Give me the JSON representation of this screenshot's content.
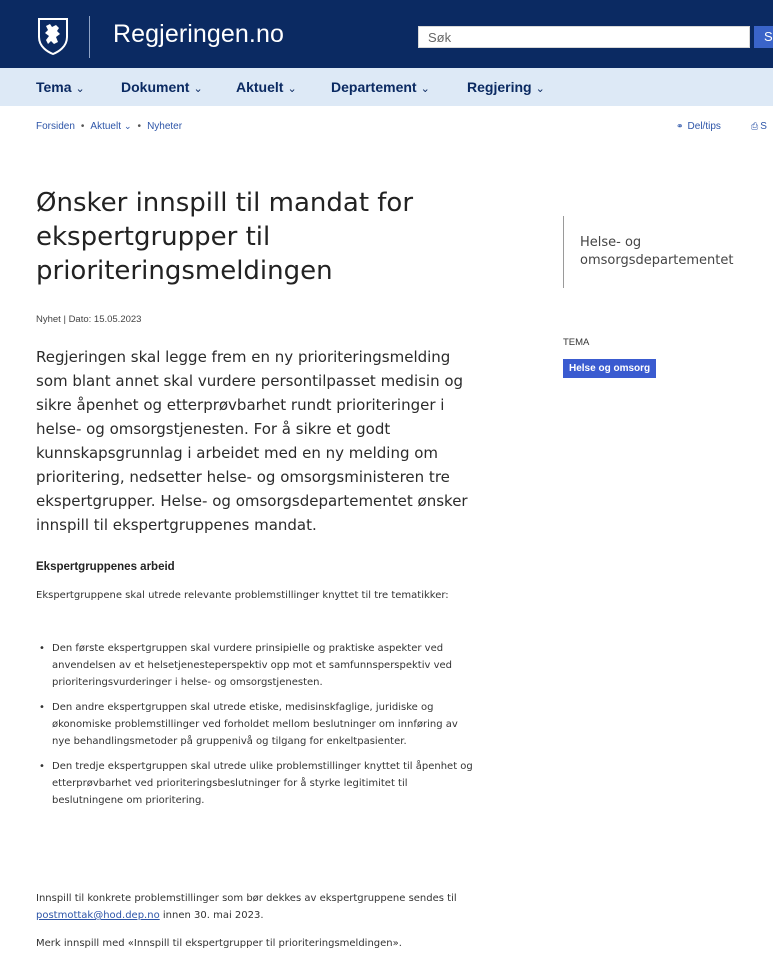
{
  "header": {
    "site_title": "Regjeringen.no",
    "search_placeholder": "Søk",
    "search_button_label": "S"
  },
  "nav": {
    "items": [
      {
        "label": "Tema"
      },
      {
        "label": "Dokument"
      },
      {
        "label": "Aktuelt"
      },
      {
        "label": "Departement"
      },
      {
        "label": "Regjering"
      }
    ]
  },
  "breadcrumb": {
    "home": "Forsiden",
    "section": "Aktuelt",
    "current": "Nyheter"
  },
  "tools": {
    "share_label": "Del/tips",
    "print_label": "S"
  },
  "article": {
    "title": "Ønsker innspill til mandat for ekspertgrupper til prioriteringsmeldingen",
    "meta": "Nyhet | Dato: 15.05.2023",
    "lead": "Regjeringen skal legge frem en ny prioriteringsmelding som blant annet skal vurdere persontilpasset medisin og sikre åpenhet og etterprøvbarhet rundt prioriteringer i helse- og omsorgstjenesten. For å sikre et godt kunnskapsgrunnlag i arbeidet med en ny melding om prioritering, nedsetter helse- og omsorgsministeren tre ekspertgrupper. Helse- og omsorgsdepartementet ønsker innspill til ekspertgruppenes mandat.",
    "subheading": "Ekspertgruppenes arbeid",
    "intro": "Ekspertgruppene skal utrede relevante problemstillinger knyttet til tre tematikker:",
    "bullets": [
      "Den første ekspertgruppen skal vurdere prinsipielle og praktiske aspekter ved anvendelsen av et helsetjenesteperspektiv opp mot et samfunnsperspektiv ved prioriteringsvurderinger i helse- og omsorgstjenesten.",
      "Den andre ekspertgruppen skal utrede etiske, medisinskfaglige, juridiske og økonomiske problemstillinger ved forholdet mellom beslutninger om innføring av nye behandlingsmetoder på gruppenivå og tilgang for enkeltpasienter.",
      "Den tredje ekspertgruppen skal utrede ulike problemstillinger knyttet til åpenhet og etterprøvbarhet ved prioriteringsbeslutninger for å styrke legitimitet til beslutningene om prioritering."
    ],
    "contact_before": "Innspill til konkrete problemstillinger som bør dekkes av ekspertgruppene sendes til ",
    "contact_email": "postmottak@hod.dep.no",
    "contact_after": " innen 30. mai 2023.",
    "closing": "Merk innspill med «Innspill til ekspertgrupper til prioriteringsmeldingen»."
  },
  "aside": {
    "department": "Helse- og omsorgsdepartementet",
    "tema_label": "TEMA",
    "tema_tag": "Helse og omsorg"
  },
  "colors": {
    "header_bg": "#0b2a62",
    "nav_bg": "#dde9f6",
    "link": "#2d55a8",
    "tag_bg": "#3a5bd0"
  },
  "icons": {
    "crest": "norwegian-lion-crest-icon",
    "share": "share-icon",
    "print": "print-icon",
    "chevron": "chevron-down-icon"
  }
}
